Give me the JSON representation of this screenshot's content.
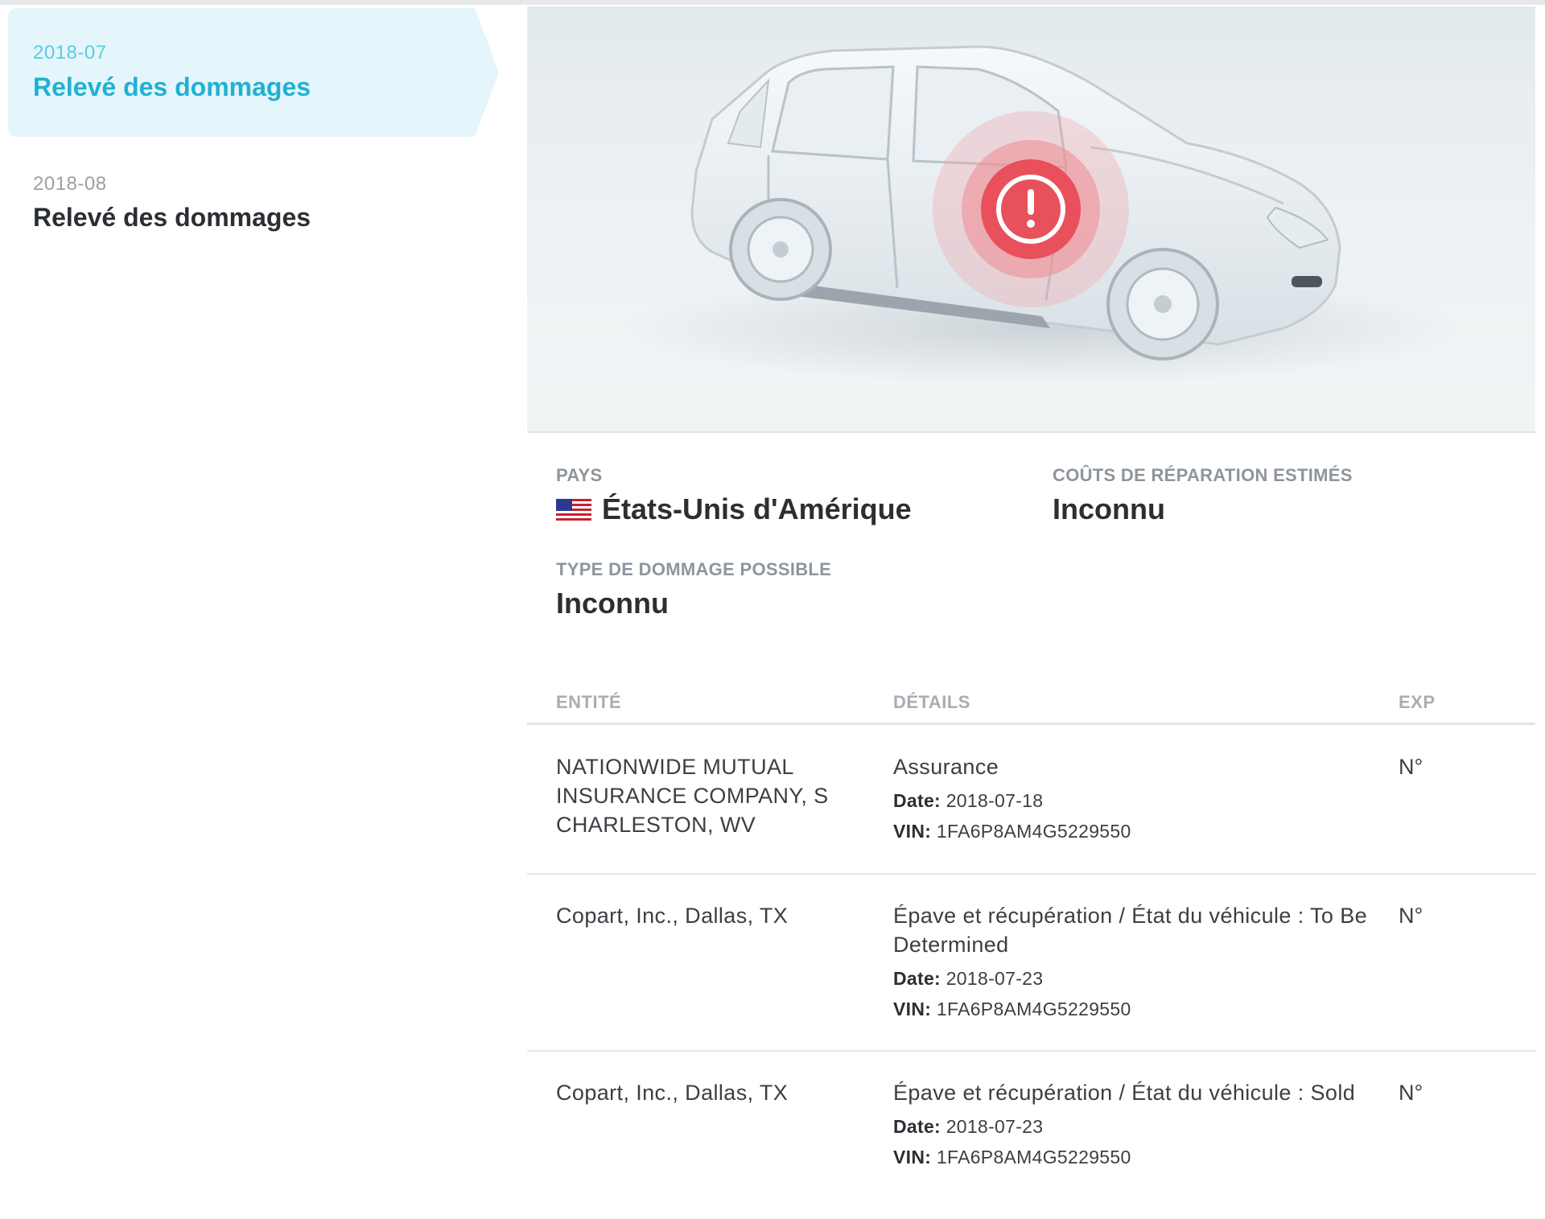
{
  "sidebar": {
    "items": [
      {
        "date": "2018-07",
        "title": "Relevé des dommages",
        "active": true
      },
      {
        "date": "2018-08",
        "title": "Relevé des dommages",
        "active": false
      }
    ]
  },
  "damage_marker": {
    "icon": "alert-circle-icon",
    "color": "#e8505b"
  },
  "summary": {
    "country_label": "PAYS",
    "country_value": "États-Unis d'Amérique",
    "country_flag": "us-flag-icon",
    "repair_cost_label": "COÛTS DE RÉPARATION ESTIMÉS",
    "repair_cost_value": "Inconnu",
    "damage_type_label": "TYPE DE DOMMAGE POSSIBLE",
    "damage_type_value": "Inconnu"
  },
  "table": {
    "headers": [
      "ENTITÉ",
      "DÉTAILS",
      "EXP"
    ],
    "date_label": "Date:",
    "vin_label": "VIN:",
    "rows": [
      {
        "entity": "NATIONWIDE MUTUAL INSURANCE COMPANY, S CHARLESTON, WV",
        "type": "Assurance",
        "date": "2018-07-18",
        "vin": "1FA6P8AM4G5229550",
        "exp": "N°"
      },
      {
        "entity": "Copart, Inc., Dallas, TX",
        "type": "Épave et récupération / État du véhicule : To Be Determined",
        "date": "2018-07-23",
        "vin": "1FA6P8AM4G5229550",
        "exp": "N°"
      },
      {
        "entity": "Copart, Inc., Dallas, TX",
        "type": "Épave et récupération / État du véhicule : Sold",
        "date": "2018-07-23",
        "vin": "1FA6P8AM4G5229550",
        "exp": "N°"
      }
    ]
  },
  "colors": {
    "accent": "#1fb1d4",
    "active_bg": "#e4f6fb",
    "damage_red": "#e8505b"
  }
}
